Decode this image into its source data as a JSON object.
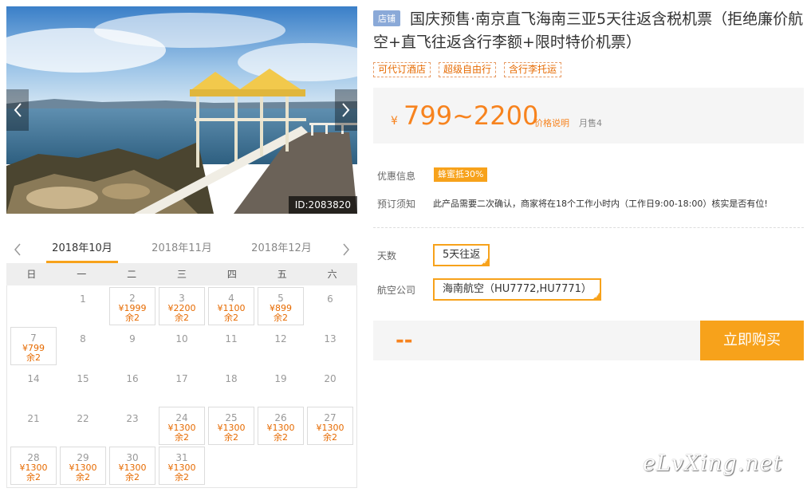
{
  "product": {
    "shop_badge": "店铺",
    "title": "国庆预售·南京直飞海南三亚5天往返含税机票（拒绝廉价航空+直飞往返含行李额+限时特价机票）",
    "tags": [
      "可代订酒店",
      "超级自由行",
      "含行李托运"
    ],
    "price_symbol": "¥",
    "price_range": "799~2200",
    "price_note": "价格说明",
    "sales": "月售4"
  },
  "gallery": {
    "image_id": "ID:2083820",
    "prev_icon": "chevron-left-icon",
    "next_icon": "chevron-right-icon"
  },
  "info": {
    "promo_label": "优惠信息",
    "promo_badge": "蜂蜜抵30%",
    "notice_label": "预订须知",
    "notice_text": "此产品需要二次确认，商家将在18个工作小时内（工作日9:00-18:00）核实是否有位!"
  },
  "options": {
    "days_label": "天数",
    "days_value": "5天往返",
    "airline_label": "航空公司",
    "airline_value": "海南航空（HU7772,HU7771）"
  },
  "purchase": {
    "total": "--",
    "buy_label": "立即购买"
  },
  "calendar": {
    "months": [
      "2018年10月",
      "2018年11月",
      "2018年12月"
    ],
    "active_month": 0,
    "weekdays": [
      "日",
      "一",
      "二",
      "三",
      "四",
      "五",
      "六"
    ],
    "days": [
      {
        "d": "1",
        "p": "",
        "r": ""
      },
      {
        "d": "2",
        "p": "¥1999",
        "r": "余2"
      },
      {
        "d": "3",
        "p": "¥2200",
        "r": "余2"
      },
      {
        "d": "4",
        "p": "¥1100",
        "r": "余2"
      },
      {
        "d": "5",
        "p": "¥899",
        "r": "余2"
      },
      {
        "d": "6",
        "p": "",
        "r": ""
      },
      {
        "d": "7",
        "p": "¥799",
        "r": "余2"
      },
      {
        "d": "8",
        "p": "",
        "r": ""
      },
      {
        "d": "9",
        "p": "",
        "r": ""
      },
      {
        "d": "10",
        "p": "",
        "r": ""
      },
      {
        "d": "11",
        "p": "",
        "r": ""
      },
      {
        "d": "12",
        "p": "",
        "r": ""
      },
      {
        "d": "13",
        "p": "",
        "r": ""
      },
      {
        "d": "14",
        "p": "",
        "r": ""
      },
      {
        "d": "15",
        "p": "",
        "r": ""
      },
      {
        "d": "16",
        "p": "",
        "r": ""
      },
      {
        "d": "17",
        "p": "",
        "r": ""
      },
      {
        "d": "18",
        "p": "",
        "r": ""
      },
      {
        "d": "19",
        "p": "",
        "r": ""
      },
      {
        "d": "20",
        "p": "",
        "r": ""
      },
      {
        "d": "21",
        "p": "",
        "r": ""
      },
      {
        "d": "22",
        "p": "",
        "r": ""
      },
      {
        "d": "23",
        "p": "",
        "r": ""
      },
      {
        "d": "24",
        "p": "¥1300",
        "r": "余2"
      },
      {
        "d": "25",
        "p": "¥1300",
        "r": "余2"
      },
      {
        "d": "26",
        "p": "¥1300",
        "r": "余2"
      },
      {
        "d": "27",
        "p": "¥1300",
        "r": "余2"
      },
      {
        "d": "28",
        "p": "¥1300",
        "r": "余2"
      },
      {
        "d": "29",
        "p": "¥1300",
        "r": "余2"
      },
      {
        "d": "30",
        "p": "¥1300",
        "r": "余2"
      },
      {
        "d": "31",
        "p": "¥1300",
        "r": "余2"
      }
    ]
  },
  "watermark": "eLvXing.net",
  "colors": {
    "accent": "#f7a21b",
    "price": "#f7831e"
  }
}
